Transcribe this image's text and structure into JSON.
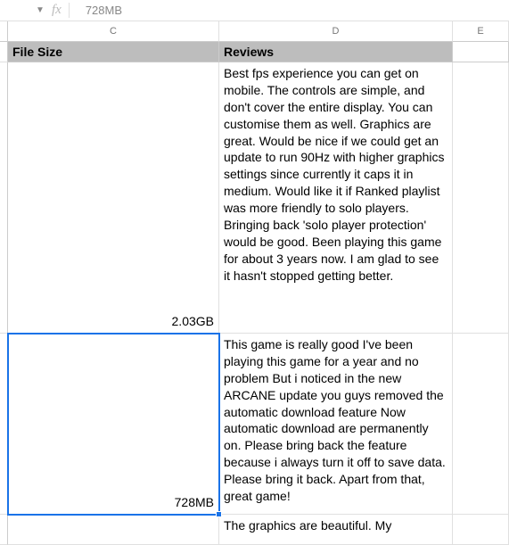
{
  "formula_bar": {
    "fx_label": "fx",
    "value": "728MB"
  },
  "columns": {
    "c": "C",
    "d": "D",
    "e": "E"
  },
  "headers": {
    "file_size": "File Size",
    "reviews": "Reviews"
  },
  "rows": [
    {
      "file_size": "2.03GB",
      "review": "Best fps experience you can get on mobile. The controls are simple, and don't cover the entire display. You can customise them as well. Graphics are great. Would be nice if we could get an update to run 90Hz with higher graphics settings since currently it caps it in medium. Would like it if Ranked playlist was more friendly to solo players. Bringing back 'solo player protection' would be good. Been playing this game for about 3 years now. I am glad to see it hasn't stopped getting better."
    },
    {
      "file_size": "728MB",
      "review": "This game is really good I've been playing this game for a year and no problem But i noticed in the new ARCANE update you guys removed the automatic download feature Now automatic download are permanently on. Please bring back the feature because i always turn it off to save data. Please bring it back. Apart from that, great game!"
    },
    {
      "file_size": "",
      "review": "The graphics are beautiful. My"
    }
  ]
}
